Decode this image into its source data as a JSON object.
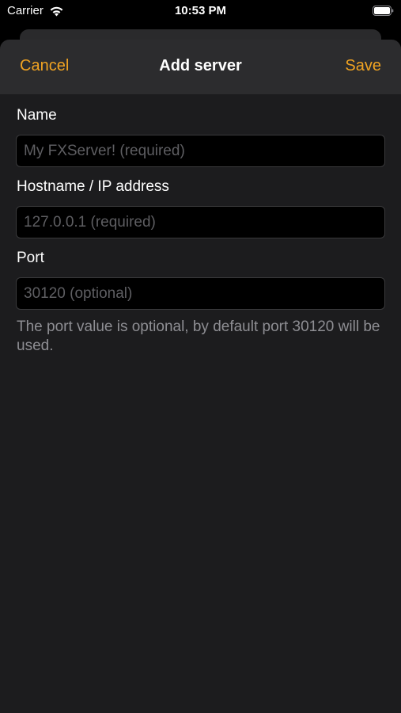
{
  "status_bar": {
    "carrier": "Carrier",
    "time": "10:53 PM",
    "icons": [
      "wifi-icon",
      "battery-icon"
    ]
  },
  "nav": {
    "cancel_label": "Cancel",
    "title": "Add server",
    "save_label": "Save",
    "accent_color": "#f0a322"
  },
  "form": {
    "name": {
      "label": "Name",
      "value": "",
      "placeholder": "My FXServer! (required)"
    },
    "hostname": {
      "label": "Hostname / IP address",
      "value": "",
      "placeholder": "127.0.0.1 (required)"
    },
    "port": {
      "label": "Port",
      "value": "",
      "placeholder": "30120 (optional)"
    },
    "help_text": "The port value is optional, by default port 30120 will be used."
  }
}
